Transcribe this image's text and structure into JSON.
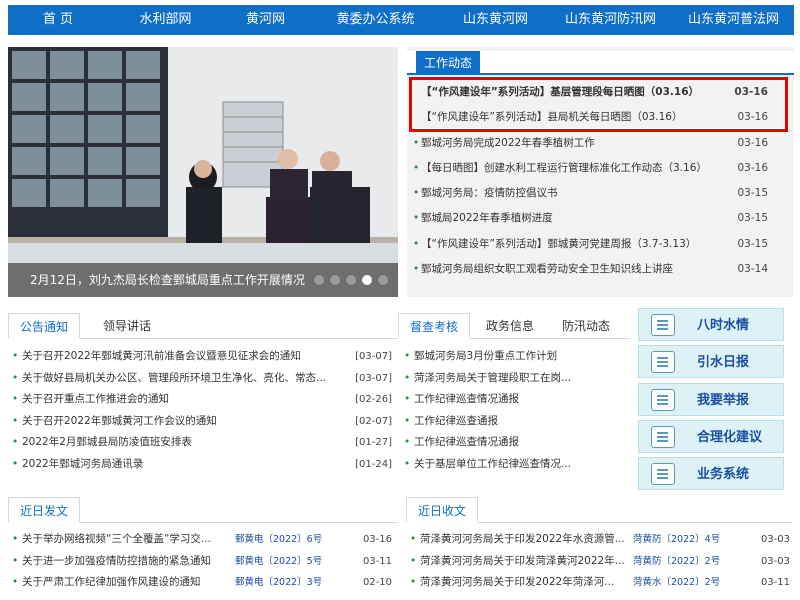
{
  "nav": [
    "首 页",
    "水利部网",
    "黄河网",
    "黄委办公系统",
    "山东黄河网",
    "山东黄河防汛网",
    "山东黄河普法网"
  ],
  "hero": {
    "caption": "2月12日，刘九杰局长检查鄄城局重点工作开展情况"
  },
  "work": {
    "tab": "工作动态",
    "items": [
      {
        "title": "【“作风建设年”系列活动】基层管理段每日晒图（03.16）",
        "date": "03-16"
      },
      {
        "title": "【“作风建设年”系列活动】县局机关每日晒图（03.16）",
        "date": "03-16"
      },
      {
        "title": "鄄城河务局完成2022年春季植树工作",
        "date": "03-16"
      },
      {
        "title": "【每日晒图】创建水利工程运行管理标准化工作动态（3.16）",
        "date": "03-16"
      },
      {
        "title": "鄄城河务局：疫情防控倡议书",
        "date": "03-15"
      },
      {
        "title": "鄄城局2022年春季植树进度",
        "date": "03-15"
      },
      {
        "title": "【“作风建设年”系列活动】鄄城黄河党建周报（3.7-3.13）",
        "date": "03-15"
      },
      {
        "title": "鄄城河务局组织女职工观看劳动安全卫生知识线上讲座",
        "date": "03-14"
      }
    ]
  },
  "notice": {
    "tabs": [
      "公告通知",
      "领导讲话"
    ],
    "items": [
      {
        "title": "关于召开2022年鄄城黄河汛前准备会议暨意见征求会的通知",
        "date": "[03-07]"
      },
      {
        "title": "关于做好县局机关办公区、管理段所环境卫生净化、亮化、常态...",
        "date": "[03-07]"
      },
      {
        "title": "关于召开重点工作推进会的通知",
        "date": "[02-26]"
      },
      {
        "title": "关于召开2022年鄄城黄河工作会议的通知",
        "date": "[02-07]"
      },
      {
        "title": "2022年2月鄄城县局防凌值班安排表",
        "date": "[01-27]"
      },
      {
        "title": "2022年鄄城河务局通讯录",
        "date": "[01-24]"
      }
    ]
  },
  "supervise": {
    "tabs": [
      "督查考核",
      "政务信息",
      "防汛动态"
    ],
    "items": [
      "鄄城河务局3月份重点工作计划",
      "菏泽河务局关于管理段职工在岗...",
      "工作纪律巡查情况通报",
      "工作纪律巡查通报",
      "工作纪律巡查情况通报",
      "关于基层单位工作纪律巡查情况..."
    ]
  },
  "side_buttons": [
    "八时水情",
    "引水日报",
    "我要举报",
    "合理化建议",
    "业务系统"
  ],
  "recent_sent": {
    "tab": "近日发文",
    "items": [
      {
        "title": "关于举办网络视频“三个全覆盖”学习交...",
        "doc": "鄄黄电〔2022〕6号",
        "date": "03-16"
      },
      {
        "title": "关于进一步加强疫情防控措施的紧急通知",
        "doc": "鄄黄电〔2022〕5号",
        "date": "03-11"
      },
      {
        "title": "关于严肃工作纪律加强作风建设的通知",
        "doc": "鄄黄电〔2022〕3号",
        "date": "02-10"
      }
    ]
  },
  "recent_recv": {
    "tab": "近日收文",
    "items": [
      {
        "title": "菏泽黄河河务局关于印发2022年水资源管...",
        "doc": "菏黄防〔2022〕4号",
        "date": "03-03"
      },
      {
        "title": "菏泽黄河河务局关于印发菏泽黄河2022年...",
        "doc": "菏黄防〔2022〕2号",
        "date": "03-03"
      },
      {
        "title": "菏泽黄河河务局关于印发2022年菏泽河...",
        "doc": "菏黄水〔2022〕2号",
        "date": "03-11"
      }
    ]
  }
}
